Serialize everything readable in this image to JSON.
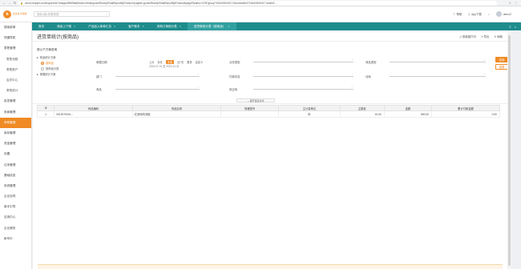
{
  "browser": {
    "url": "cloud.chanjet.com/hsy/a4nbr74daqsn/89b5ba8/index.html#/goodsReceiptTotalReportByProduct?pageId=goodsReceiptTotalReportByProduct&pageParams=%7B\"group\"%3A1054%2C\"menuNodeId\"%3A1084%2C\"routeId\"..."
  },
  "header": {
    "logo_mark": "b",
    "logo_text": "好生意\n标准版",
    "search_placeholder": "搜索功能/单据/数据",
    "help": "帮助",
    "app_download": "App下载",
    "user": "demo2"
  },
  "sidebar": {
    "items": [
      {
        "label": "搜索菜单",
        "sub": false,
        "active": false
      },
      {
        "label": "快捷导航",
        "sub": false,
        "active": false
      },
      {
        "label": "零售管理",
        "sub": false,
        "active": false
      },
      {
        "label": "零售流程",
        "sub": true,
        "active": false
      },
      {
        "label": "零售账户",
        "sub": true,
        "active": false
      },
      {
        "label": "会员中心",
        "sub": true,
        "active": false
      },
      {
        "label": "零售统计",
        "sub": true,
        "active": false
      },
      {
        "label": "批发管理",
        "sub": false,
        "active": false
      },
      {
        "label": "电商管理",
        "sub": false,
        "active": false
      },
      {
        "label": "采购管理",
        "sub": false,
        "active": true
      },
      {
        "label": "库存管理",
        "sub": false,
        "active": false
      },
      {
        "label": "资金管理",
        "sub": false,
        "active": false
      },
      {
        "label": "设置",
        "sub": false,
        "active": false
      },
      {
        "label": "往来管理",
        "sub": false,
        "active": false
      },
      {
        "label": "基础信息",
        "sub": false,
        "active": false
      },
      {
        "label": "系统管理",
        "sub": false,
        "active": false
      },
      {
        "label": "企业协同",
        "sub": false,
        "active": false
      },
      {
        "label": "新手引导",
        "sub": false,
        "active": false
      },
      {
        "label": "应用中心",
        "sub": false,
        "active": false
      },
      {
        "label": "企业服务",
        "sub": false,
        "active": false
      },
      {
        "label": "帐号中",
        "sub": false,
        "active": false
      }
    ]
  },
  "tabs": [
    {
      "label": "首页",
      "closable": false,
      "active": false
    },
    {
      "label": "商品上下架",
      "closable": true,
      "active": false
    },
    {
      "label": "产品品入库单汇总",
      "closable": true,
      "active": false
    },
    {
      "label": "客户账本",
      "closable": true,
      "active": false
    },
    {
      "label": "采购订单统计表",
      "closable": true,
      "active": false
    },
    {
      "label": "进货单统计表（按商品）",
      "closable": true,
      "active": true
    }
  ],
  "page": {
    "title": "进货单统计(按商品)",
    "actions": [
      "按维度打印",
      "导出",
      "刷新"
    ]
  },
  "filter": {
    "tree_title": "按以下方案查询",
    "tree_nodes": [
      {
        "label": "商品统计方案",
        "level": 1,
        "radio": "none",
        "selected": false
      },
      {
        "label": "按商品",
        "level": 2,
        "radio": "on",
        "selected": true
      },
      {
        "label": "按商品分类",
        "level": 2,
        "radio": "off",
        "selected": false
      },
      {
        "label": "单据统计方案",
        "level": 1,
        "radio": "none",
        "selected": false
      }
    ],
    "date_label": "单据日期",
    "date_options": [
      "上月",
      "本月",
      "本周",
      "近7天",
      "更多",
      "自定义"
    ],
    "date_active": "本周",
    "date_range": "2023-07-01 至 2023-12-31",
    "fields": {
      "supplier": "供应商",
      "department": "部门",
      "clerk": "业务员",
      "warehouse": "仓库",
      "business_type": "业务类型",
      "receipt_status": "付款状态",
      "product_type": "商品类型",
      "product": "商品",
      "group": "供应商"
    },
    "more": "⌄ 展开更多条件",
    "search_btn": "查询",
    "reset_btn": "重置"
  },
  "table": {
    "headers": [
      "",
      "商品编码",
      "商品名称",
      "规格型号",
      "主计量单位",
      "主数量",
      "金额",
      "累计付款金额"
    ],
    "rows": [
      [
        "1",
        "0010070001...",
        "红烧鸡肉汤饭",
        "",
        "份",
        "10.00",
        "800.00",
        "0.00"
      ]
    ]
  }
}
